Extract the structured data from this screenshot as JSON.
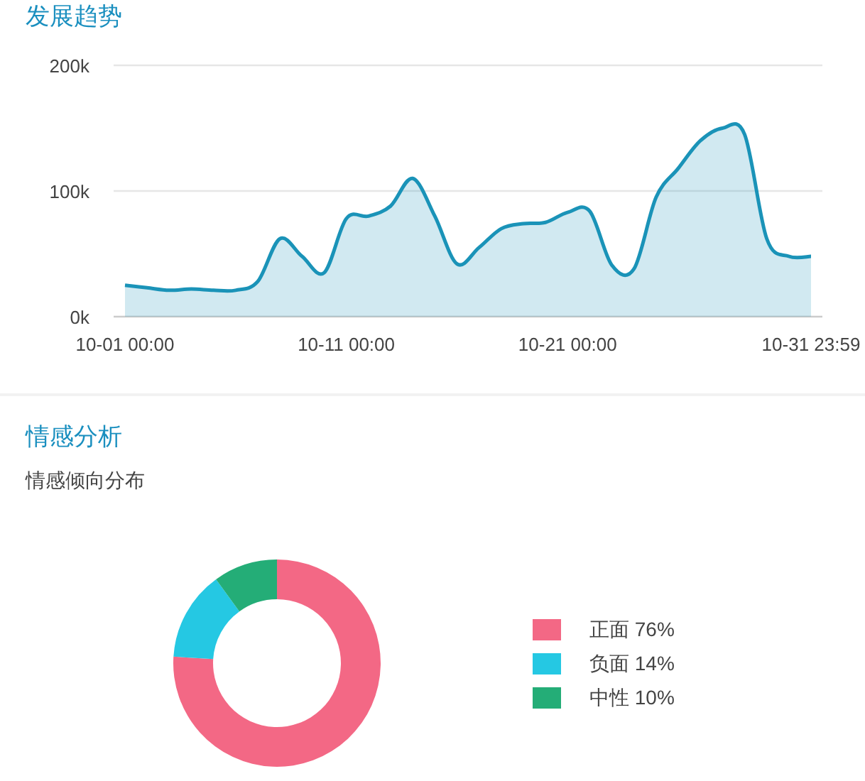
{
  "trend": {
    "title": "发展趋势",
    "chart_data": {
      "type": "area",
      "categories": [
        "10-01 00:00",
        null,
        null,
        null,
        null,
        null,
        null,
        null,
        null,
        null,
        "10-11 00:00",
        null,
        null,
        null,
        null,
        null,
        null,
        null,
        null,
        null,
        "10-21 00:00",
        null,
        null,
        null,
        null,
        null,
        null,
        null,
        null,
        null,
        null,
        "10-31 23:59"
      ],
      "series": [
        {
          "color": "#1a93b8",
          "values": [
            25,
            23,
            21,
            22,
            21,
            21,
            28,
            62,
            48,
            35,
            78,
            80,
            88,
            110,
            80,
            42,
            55,
            70,
            74,
            75,
            83,
            84,
            41,
            38,
            95,
            118,
            140,
            150,
            145,
            62,
            48,
            48
          ]
        }
      ],
      "ylim": [
        0,
        200
      ],
      "yticks": [
        {
          "value": 0,
          "label": "0k"
        },
        {
          "value": 100,
          "label": "100k"
        },
        {
          "value": 200,
          "label": "200k"
        }
      ]
    }
  },
  "sentiment": {
    "title": "情感分析",
    "subtitle": "情感倾向分布",
    "chart_data": {
      "type": "donut",
      "categories": [
        "正面",
        "负面",
        "中性"
      ],
      "series": [
        {
          "values": [
            76,
            14,
            10
          ]
        }
      ],
      "colors": [
        "#f36885",
        "#25c8e3",
        "#24ad77"
      ],
      "value_labels": [
        "76%",
        "14%",
        "10%"
      ]
    }
  }
}
